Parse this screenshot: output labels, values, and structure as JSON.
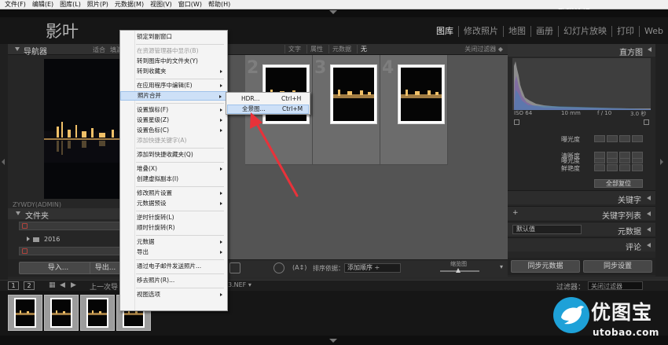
{
  "os_menu": [
    "文件(F)",
    "编辑(E)",
    "图库(L)",
    "照片(P)",
    "元数据(M)",
    "视图(V)",
    "窗口(W)",
    "帮助(H)"
  ],
  "watermark_top": "PS教程论坛 www.16XX8.com",
  "identity_plate": "影叶",
  "modules": [
    {
      "label": "图库",
      "active": true
    },
    {
      "label": "修改照片",
      "active": false
    },
    {
      "label": "地图",
      "active": false
    },
    {
      "label": "画册",
      "active": false
    },
    {
      "label": "幻灯片放映",
      "active": false
    },
    {
      "label": "打印",
      "active": false
    },
    {
      "label": "Web",
      "active": false
    }
  ],
  "navigator": {
    "title": "导航器",
    "options": [
      "适合",
      "填满"
    ]
  },
  "folders": {
    "title": "文件夹",
    "sub_label": "ZYWDY(ADMIN)",
    "year": "2016"
  },
  "left_buttons": {
    "import": "导入...",
    "export": "导出..."
  },
  "filter_bar": {
    "options": [
      "文字",
      "属性",
      "元数据",
      "无"
    ],
    "active": "无",
    "preset": "关闭过滤器 ◆"
  },
  "grid_cells": [
    {
      "num": "2"
    },
    {
      "num": "3"
    },
    {
      "num": "4"
    }
  ],
  "toolbar": {
    "sort_label": "排序依据：",
    "sort_value": "添加顺序 ÷",
    "thumb_label": "缩览图"
  },
  "histogram": {
    "title": "直方图",
    "exif": [
      "ISO 64",
      "10 mm",
      "f / 10",
      "3.0 秒"
    ]
  },
  "quick_develop": {
    "rows": [
      "曝光度",
      "清晰度",
      "鲜艳度"
    ],
    "reset": "全部复位"
  },
  "right_sections": {
    "keywords": "关键字",
    "keyword_list": "关键字列表",
    "keyword_list_plus": "+",
    "metadata": "元数据",
    "metadata_preset": "默认值",
    "comments": "评论"
  },
  "sync_buttons": {
    "sync_metadata": "同步元数据",
    "sync_settings": "同步设置"
  },
  "filmbar": {
    "page1": "1",
    "page2": "2",
    "prev_import": "上一次导",
    "filename_tail": "3.NEF ▾",
    "filter_label": "过滤器：",
    "filter_value": "关闭过滤器"
  },
  "context_menu": {
    "items": [
      {
        "label": "锁定到副窗口",
        "disabled": false,
        "submenu": false,
        "highlight": false
      },
      {
        "sep": true
      },
      {
        "label": "在资源管理器中显示(B)",
        "disabled": true,
        "submenu": false,
        "highlight": false
      },
      {
        "label": "转到图库中的文件夹(Y)",
        "disabled": false,
        "submenu": false,
        "highlight": false
      },
      {
        "label": "转到收藏夹",
        "disabled": false,
        "submenu": true,
        "highlight": false
      },
      {
        "sep": true
      },
      {
        "label": "在应用程序中编辑(E)",
        "disabled": false,
        "submenu": true,
        "highlight": false
      },
      {
        "label": "照片合并",
        "disabled": false,
        "submenu": true,
        "highlight": true
      },
      {
        "sep": true
      },
      {
        "label": "设置旗标(F)",
        "disabled": false,
        "submenu": true,
        "highlight": false
      },
      {
        "label": "设置星级(Z)",
        "disabled": false,
        "submenu": true,
        "highlight": false
      },
      {
        "label": "设置色标(C)",
        "disabled": false,
        "submenu": true,
        "highlight": false
      },
      {
        "label": "添加快捷关键字(A)",
        "disabled": true,
        "submenu": false,
        "highlight": false
      },
      {
        "sep": true
      },
      {
        "label": "添加到快捷收藏夹(Q)",
        "disabled": false,
        "submenu": false,
        "highlight": false
      },
      {
        "sep": true
      },
      {
        "label": "堆叠(X)",
        "disabled": false,
        "submenu": true,
        "highlight": false
      },
      {
        "label": "创建虚拟副本(I)",
        "disabled": false,
        "submenu": false,
        "highlight": false
      },
      {
        "sep": true
      },
      {
        "label": "修改照片设置",
        "disabled": false,
        "submenu": true,
        "highlight": false
      },
      {
        "label": "元数据预设",
        "disabled": false,
        "submenu": true,
        "highlight": false
      },
      {
        "sep": true
      },
      {
        "label": "逆时针旋转(L)",
        "disabled": false,
        "submenu": false,
        "highlight": false
      },
      {
        "label": "顺时针旋转(R)",
        "disabled": false,
        "submenu": false,
        "highlight": false
      },
      {
        "sep": true
      },
      {
        "label": "元数据",
        "disabled": false,
        "submenu": true,
        "highlight": false
      },
      {
        "label": "导出",
        "disabled": false,
        "submenu": true,
        "highlight": false
      },
      {
        "sep": true
      },
      {
        "label": "通过电子邮件发送照片...",
        "disabled": false,
        "submenu": false,
        "highlight": false
      },
      {
        "sep": true
      },
      {
        "label": "移去照片(R)...",
        "disabled": false,
        "submenu": false,
        "highlight": false
      },
      {
        "sep": true
      },
      {
        "label": "视图选项",
        "disabled": false,
        "submenu": true,
        "highlight": false
      }
    ]
  },
  "submenu": {
    "items": [
      {
        "label": "HDR...",
        "shortcut": "Ctrl+H",
        "highlight": false
      },
      {
        "label": "全景图...",
        "shortcut": "Ctrl+M",
        "highlight": true
      }
    ]
  },
  "site_logo": {
    "name": "优图宝",
    "url": "utobao.com"
  },
  "colors": {
    "accent_arrow": "#e8323a",
    "menu_highlight": "#cde0f7",
    "logo_blue": "#1ea1d8"
  }
}
